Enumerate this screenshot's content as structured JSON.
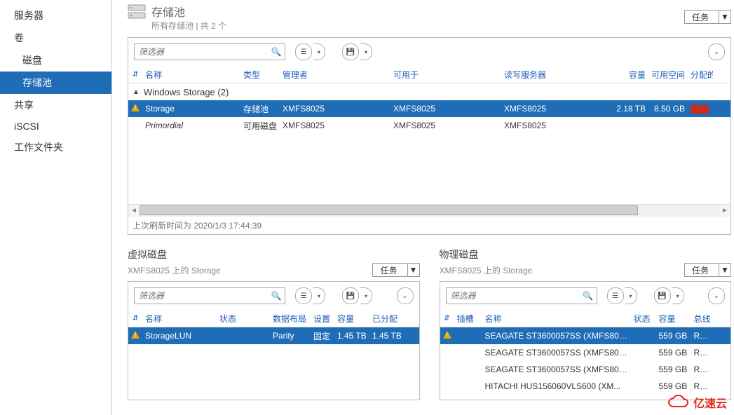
{
  "nav": {
    "items": [
      "服务器",
      "卷",
      "磁盘",
      "存储池",
      "共享",
      "iSCSI",
      "工作文件夹"
    ],
    "selected_index": 3
  },
  "header": {
    "title": "存储池",
    "subtitle": "所有存储池 | 共 2 个"
  },
  "tasks_label": "任务",
  "filter_placeholder": "筛选器",
  "pool_panel": {
    "columns": {
      "name": "名称",
      "type": "类型",
      "manager": "管理者",
      "available_for": "可用于",
      "rw_server": "读写服务器",
      "capacity": "容量",
      "free": "可用空间",
      "alloc": "分配的"
    },
    "group_label": "Windows Storage (2)",
    "rows": [
      {
        "warn": true,
        "name": "Storage",
        "type": "存储池",
        "manager": "XMFS8025",
        "available_for": "XMFS8025",
        "rw_server": "XMFS8025",
        "capacity": "2.18 TB",
        "free": "8.50 GB",
        "bar": true,
        "selected": true
      },
      {
        "warn": false,
        "name": "Primordial",
        "italic": true,
        "type": "可用磁盘",
        "manager": "XMFS8025",
        "available_for": "XMFS8025",
        "rw_server": "XMFS8025",
        "capacity": "",
        "free": "",
        "bar": false,
        "selected": false
      }
    ],
    "footer": "上次刷新时间为 2020/1/3 17:44:39"
  },
  "vdisk_panel": {
    "title": "虚拟磁盘",
    "subtitle": "XMFS8025 上的 Storage",
    "columns": {
      "name": "名称",
      "state": "状态",
      "layout": "数据布局",
      "settings": "设置",
      "capacity": "容量",
      "allocated": "已分配"
    },
    "rows": [
      {
        "warn": true,
        "name": "StorageLUN",
        "state": "",
        "layout": "Parity",
        "settings": "固定",
        "capacity": "1.45 TB",
        "allocated": "1.45 TB",
        "selected": true
      }
    ]
  },
  "pdisk_panel": {
    "title": "物理磁盘",
    "subtitle": "XMFS8025 上的 Storage",
    "columns": {
      "slot": "插槽",
      "name": "名称",
      "state": "状态",
      "capacity": "容量",
      "bus": "总线"
    },
    "rows": [
      {
        "warn": true,
        "name": "SEAGATE ST3600057SS (XMFS802...",
        "capacity": "559 GB",
        "bus": "RAID",
        "selected": true
      },
      {
        "warn": false,
        "name": "SEAGATE ST3600057SS (XMFS802...",
        "capacity": "559 GB",
        "bus": "RAID"
      },
      {
        "warn": false,
        "name": "SEAGATE ST3600057SS (XMFS802...",
        "capacity": "559 GB",
        "bus": "RAID"
      },
      {
        "warn": false,
        "name": "HITACHI HUS156060VLS600 (XM...",
        "capacity": "559 GB",
        "bus": "RAID"
      }
    ]
  },
  "logo_text": "亿速云"
}
